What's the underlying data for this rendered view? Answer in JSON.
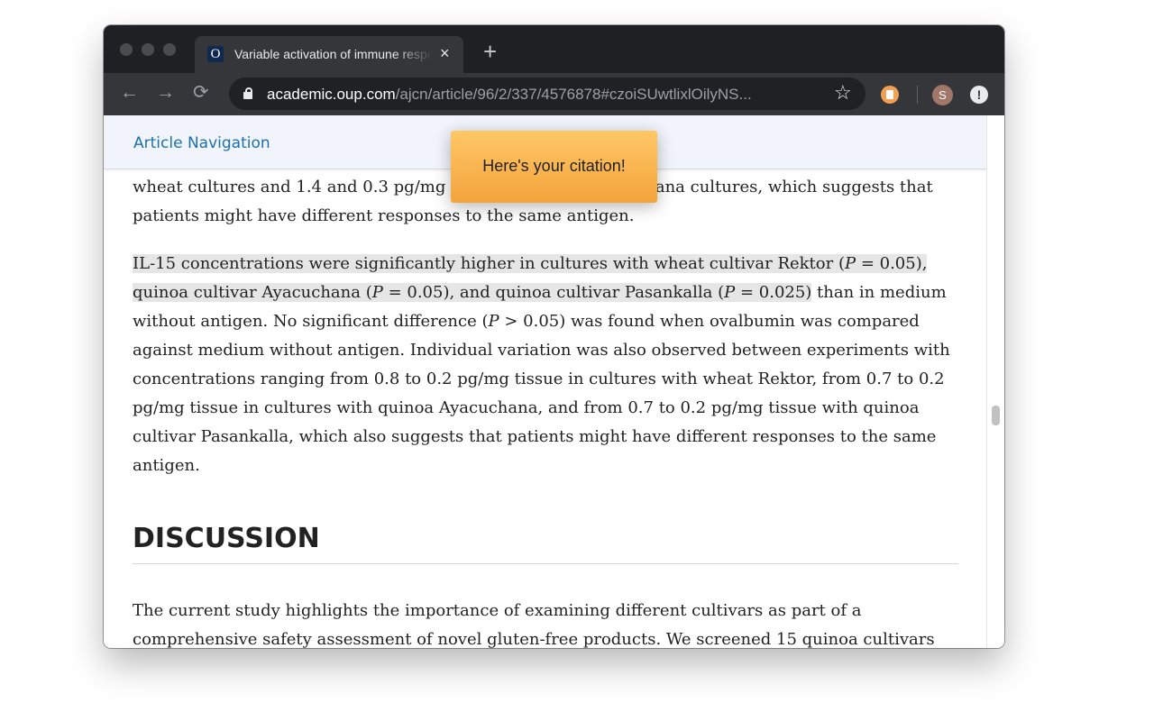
{
  "browser": {
    "tab_title": "Variable activation of immune response by quinoa",
    "tab_close": "×",
    "new_tab": "+",
    "url_host": "academic.oup.com",
    "url_path": "/ajcn/article/96/2/337/4576878#czoiSUwtlixlOilyNS...",
    "avatar_letter": "S",
    "update_glyph": "!",
    "favicon_letter": "O"
  },
  "article": {
    "nav_label": "Article Navigation",
    "clip_line": "wheat cultures and 1.4 and 0.3 pg/mg tissue in quinoa Ayacuchana cultures, which suggests that",
    "clip_line_2": "patients might have different responses to the same antigen.",
    "para_main": {
      "seg1": "IL-15 concentrations were significantly higher in cultures with wheat cultivar Rektor (",
      "p1": "P",
      "seg2": " = 0.05), quinoa cultivar Ayacuchana (",
      "p2": "P",
      "seg3": " = 0.05), and quinoa cultivar Pasankalla (",
      "p3": "P",
      "seg4": " = 0.025)",
      "seg5": " than in medium without antigen. No significant difference (",
      "p4": "P",
      "seg6": " > 0.05) was found when ovalbumin was compared against medium without antigen. Individual variation was also observed between experiments with concentrations ranging from 0.8 to 0.2 pg/mg tissue in cultures with wheat Rektor, from 0.7 to 0.2 pg/mg tissue in cultures with quinoa Ayacuchana, and from 0.7 to 0.2 pg/mg tissue with quinoa cultivar Pasankalla, which also suggests that patients might have different responses to the same antigen."
    },
    "section_heading": "DISCUSSION",
    "discussion_text": "The current study highlights the importance of examining different cultivars as part of a comprehensive safety assessment of novel gluten-free products. We screened 15 quinoa cultivars"
  },
  "tooltip": {
    "text": "Here's your citation!"
  },
  "colors": {
    "accent_link": "#1e6faa",
    "tooltip": "#f4a43c"
  }
}
